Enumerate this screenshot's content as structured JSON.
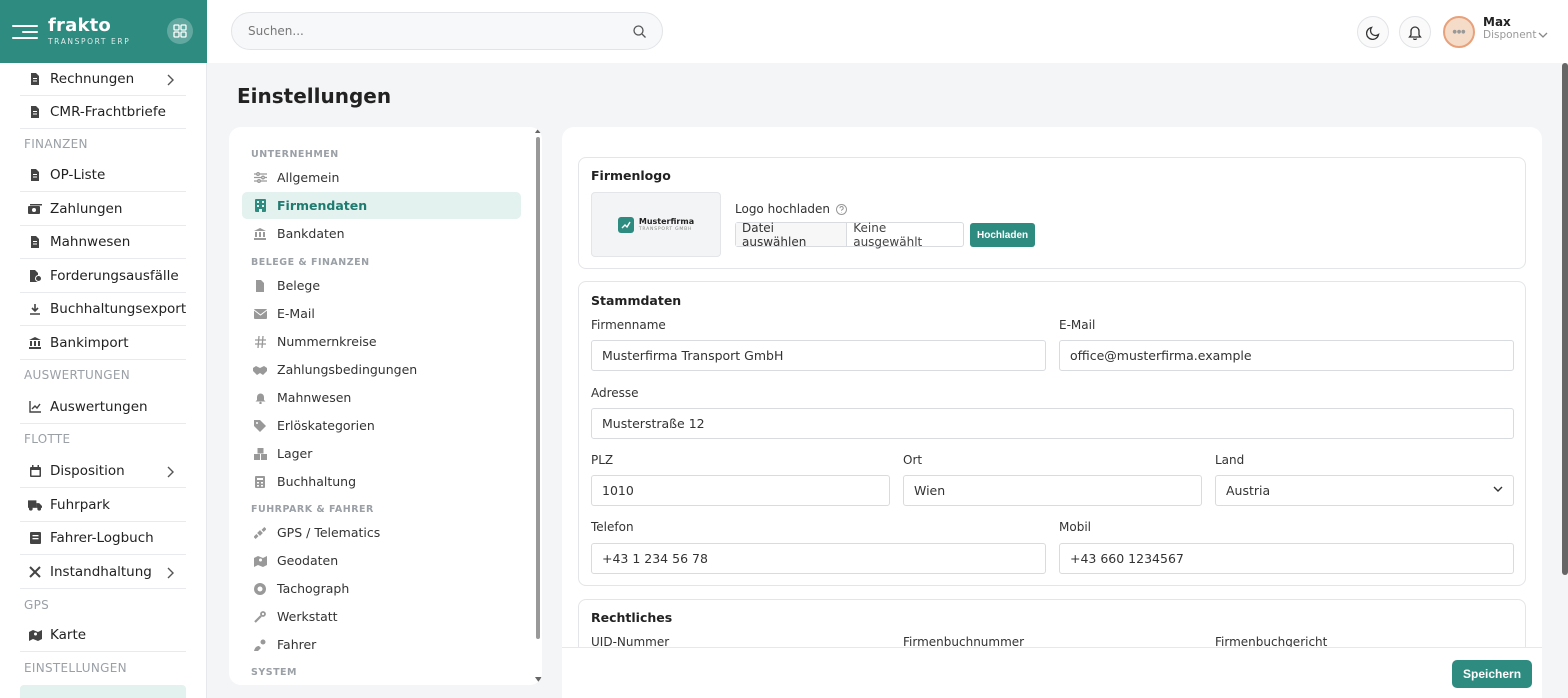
{
  "brand": {
    "name": "frakto",
    "tagline": "TRANSPORT ERP"
  },
  "sidebar": {
    "items": [
      {
        "key": "rechnungen",
        "label": "Rechnungen",
        "icon": "document-icon",
        "chevron": true
      },
      {
        "key": "cmr",
        "label": "CMR-Frachtbriefe",
        "icon": "document-icon"
      },
      {
        "key": "op",
        "label": "OP-Liste",
        "icon": "document-icon"
      },
      {
        "key": "zahlungen",
        "label": "Zahlungen",
        "icon": "money-icon"
      },
      {
        "key": "mahnwesen",
        "label": "Mahnwesen",
        "icon": "document-icon"
      },
      {
        "key": "forderung",
        "label": "Forderungsausfälle",
        "icon": "document-x-icon"
      },
      {
        "key": "export",
        "label": "Buchhaltungsexport",
        "icon": "download-icon"
      },
      {
        "key": "bankimport",
        "label": "Bankimport",
        "icon": "bank-icon"
      },
      {
        "key": "auswertungen",
        "label": "Auswertungen",
        "icon": "chart-line-icon"
      },
      {
        "key": "disposition",
        "label": "Disposition",
        "icon": "calendar-icon",
        "chevron": true
      },
      {
        "key": "fuhrpark",
        "label": "Fuhrpark",
        "icon": "truck-icon"
      },
      {
        "key": "logbuch",
        "label": "Fahrer-Logbuch",
        "icon": "book-icon"
      },
      {
        "key": "instandhaltung",
        "label": "Instandhaltung",
        "icon": "tools-icon",
        "chevron": true
      },
      {
        "key": "karte",
        "label": "Karte",
        "icon": "map-icon"
      }
    ],
    "sections": {
      "finanzen": "FINANZEN",
      "auswertungen": "AUSWERTUNGEN",
      "flotte": "FLOTTE",
      "gps": "GPS",
      "einstellungen": "EINSTELLUNGEN"
    }
  },
  "header": {
    "search_placeholder": "Suchen...",
    "user_name": "Max",
    "user_role": "Disponent"
  },
  "page": {
    "title": "Einstellungen"
  },
  "settings_nav": {
    "headings": {
      "unternehmen": "UNTERNEHMEN",
      "belege": "BELEGE & FINANZEN",
      "fuhrpark": "FUHRPARK & FAHRER",
      "system": "SYSTEM"
    },
    "items": [
      {
        "label": "Allgemein",
        "icon": "sliders-icon"
      },
      {
        "label": "Firmendaten",
        "icon": "building-icon",
        "active": true
      },
      {
        "label": "Bankdaten",
        "icon": "bank-icon"
      },
      {
        "label": "Belege",
        "icon": "document-icon"
      },
      {
        "label": "E-Mail",
        "icon": "mail-icon"
      },
      {
        "label": "Nummernkreise",
        "icon": "hash-icon"
      },
      {
        "label": "Zahlungsbedingungen",
        "icon": "handshake-icon"
      },
      {
        "label": "Mahnwesen",
        "icon": "bell-icon"
      },
      {
        "label": "Erlöskategorien",
        "icon": "tags-icon"
      },
      {
        "label": "Lager",
        "icon": "warehouse-icon"
      },
      {
        "label": "Buchhaltung",
        "icon": "calculator-icon"
      },
      {
        "label": "GPS / Telematics",
        "icon": "satellite-icon"
      },
      {
        "label": "Geodaten",
        "icon": "map-icon"
      },
      {
        "label": "Tachograph",
        "icon": "tachograph-icon"
      },
      {
        "label": "Werkstatt",
        "icon": "wrench-icon"
      },
      {
        "label": "Fahrer",
        "icon": "driver-icon"
      }
    ]
  },
  "logo_section": {
    "title": "Firmenlogo",
    "preview_name": "Musterfirma",
    "preview_tagline": "TRANSPORT GMBH",
    "upload_label": "Logo hochladen",
    "file_button": "Datei auswählen",
    "file_status": "Keine ausgewählt",
    "upload_button": "Hochladen"
  },
  "stammdaten": {
    "title": "Stammdaten",
    "firmenname_label": "Firmenname",
    "firmenname": "Musterfirma Transport GmbH",
    "email_label": "E-Mail",
    "email": "office@musterfirma.example",
    "adresse_label": "Adresse",
    "adresse": "Musterstraße 12",
    "plz_label": "PLZ",
    "plz": "1010",
    "ort_label": "Ort",
    "ort": "Wien",
    "land_label": "Land",
    "land": "Austria",
    "telefon_label": "Telefon",
    "telefon": "+43 1 234 56 78",
    "mobil_label": "Mobil",
    "mobil": "+43 660 1234567"
  },
  "rechtliches": {
    "title": "Rechtliches",
    "uid_label": "UID-Nummer",
    "fbn_label": "Firmenbuchnummer",
    "fbg_label": "Firmenbuchgericht"
  },
  "actions": {
    "save": "Speichern"
  },
  "colors": {
    "accent": "#2e8b80",
    "accent_light": "#e3f1ef"
  }
}
